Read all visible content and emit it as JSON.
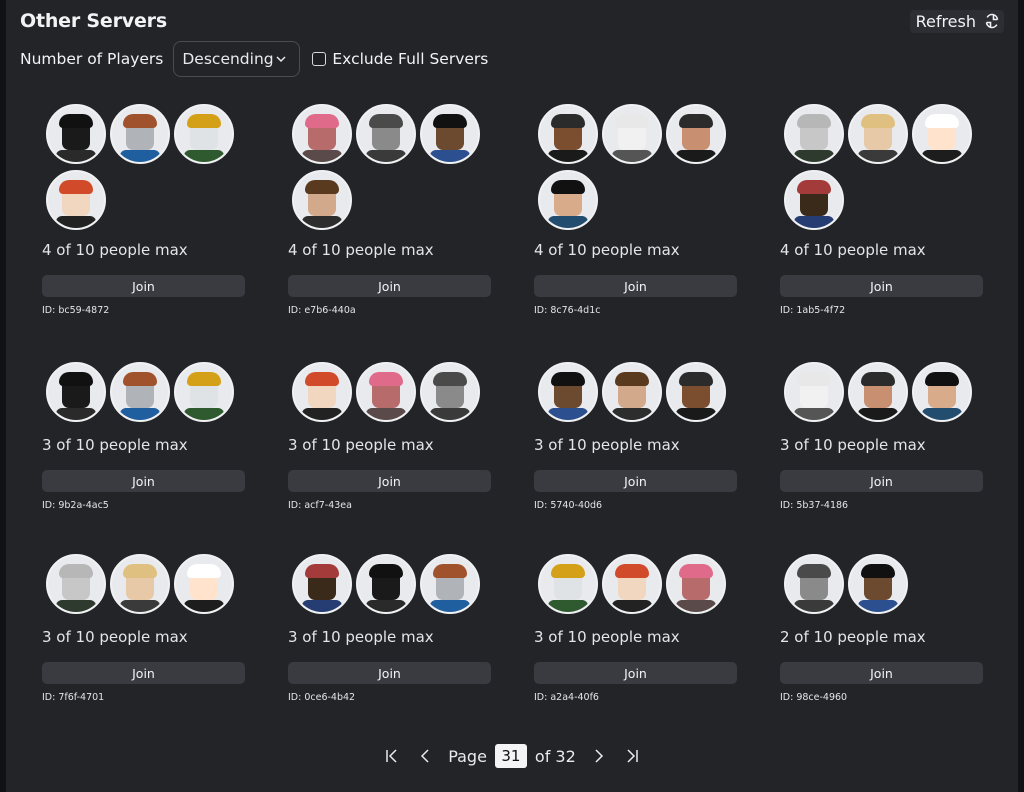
{
  "header": {
    "title": "Other Servers",
    "refresh_label": "Refresh"
  },
  "filters": {
    "sort_label": "Number of Players",
    "sort_value": "Descending",
    "exclude_full_label": "Exclude Full Servers",
    "exclude_full_checked": false
  },
  "join_label": "Join",
  "servers": [
    {
      "count_text": "4 of 10 people max",
      "id_text": "ID: bc59-4872",
      "avatars": 4
    },
    {
      "count_text": "4 of 10 people max",
      "id_text": "ID: e7b6-440a",
      "avatars": 4
    },
    {
      "count_text": "4 of 10 people max",
      "id_text": "ID: 8c76-4d1c",
      "avatars": 4
    },
    {
      "count_text": "4 of 10 people max",
      "id_text": "ID: 1ab5-4f72",
      "avatars": 4
    },
    {
      "count_text": "3 of 10 people max",
      "id_text": "ID: 9b2a-4ac5",
      "avatars": 3
    },
    {
      "count_text": "3 of 10 people max",
      "id_text": "ID: acf7-43ea",
      "avatars": 3
    },
    {
      "count_text": "3 of 10 people max",
      "id_text": "ID: 5740-40d6",
      "avatars": 3
    },
    {
      "count_text": "3 of 10 people max",
      "id_text": "ID: 5b37-4186",
      "avatars": 3
    },
    {
      "count_text": "3 of 10 people max",
      "id_text": "ID: 7f6f-4701",
      "avatars": 3
    },
    {
      "count_text": "3 of 10 people max",
      "id_text": "ID: 0ce6-4b42",
      "avatars": 3
    },
    {
      "count_text": "3 of 10 people max",
      "id_text": "ID: a2a4-40f6",
      "avatars": 3
    },
    {
      "count_text": "2 of 10 people max",
      "id_text": "ID: 98ce-4960",
      "avatars": 2
    }
  ],
  "avatar_styles": [
    {
      "hair": "#111111",
      "head": "#1a1a1a",
      "torso": "#2a2a2a"
    },
    {
      "hair": "#a0522d",
      "head": "#b0b3b8",
      "torso": "#1f5f9f"
    },
    {
      "hair": "#d4a017",
      "head": "#dfe3e6",
      "torso": "#2f5a2f"
    },
    {
      "hair": "#d14b2a",
      "head": "#f2d7c0",
      "torso": "#222222"
    },
    {
      "hair": "#e06a8a",
      "head": "#b86b6b",
      "torso": "#5a4a4a"
    },
    {
      "hair": "#4a4a4a",
      "head": "#8a8a8a",
      "torso": "#3a3a3a"
    },
    {
      "hair": "#111111",
      "head": "#6b4a2f",
      "torso": "#2b4f8f"
    },
    {
      "hair": "#5a3a1f",
      "head": "#d2a98a",
      "torso": "#2d2d2d"
    },
    {
      "hair": "#2b2b2b",
      "head": "#7a4e2f",
      "torso": "#1a1a1a"
    },
    {
      "hair": "#e8e8e8",
      "head": "#f1f1f1",
      "torso": "#555555"
    },
    {
      "hair": "#2b2b2b",
      "head": "#c89070",
      "torso": "#1a1a1a"
    },
    {
      "hair": "#111111",
      "head": "#d8ab8a",
      "torso": "#234d6e"
    },
    {
      "hair": "#b7b7b7",
      "head": "#c7c7c7",
      "torso": "#2d3a2d"
    },
    {
      "hair": "#e0c080",
      "head": "#e7c9a8",
      "torso": "#3a3a3a"
    },
    {
      "hair": "#ffffff",
      "head": "#ffe3cc",
      "torso": "#1d1d1d"
    },
    {
      "hair": "#a33b3b",
      "head": "#3a2a1a",
      "torso": "#263d73"
    }
  ],
  "pagination": {
    "page_label": "Page",
    "current_page": "31",
    "of_label": "of 32"
  }
}
